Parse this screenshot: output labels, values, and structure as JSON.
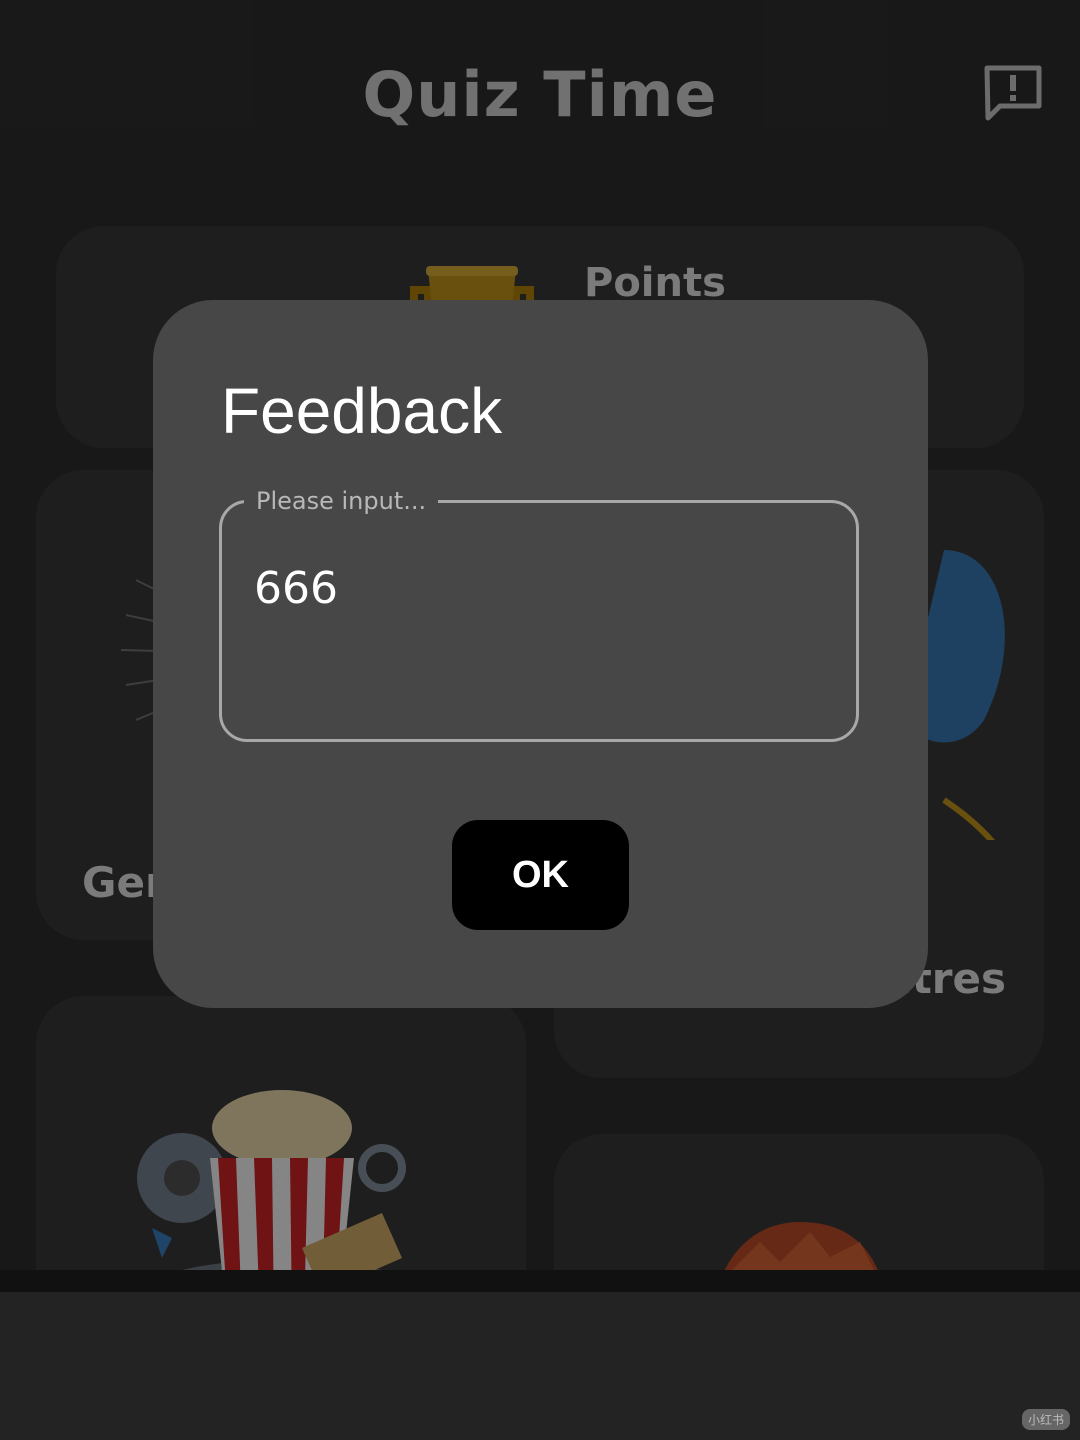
{
  "status_bar": {
    "fragment": ""
  },
  "header": {
    "title": "Quiz Time",
    "feedback_icon": "feedback-icon"
  },
  "cards": {
    "points": {
      "label": "Points",
      "icon": "trophy-icon"
    },
    "general": {
      "label": "Ger"
    },
    "theatres": {
      "label": "atres"
    },
    "movies": {
      "icon": "popcorn-ticket-image"
    },
    "anime": {
      "icon": "anime-character-image"
    }
  },
  "dialog": {
    "title": "Feedback",
    "input_placeholder": "Please input...",
    "input_value": "666",
    "ok_label": "OK"
  },
  "watermark": "小红书",
  "colors": {
    "background": "#2f2f2f",
    "card": "#3b3b3b",
    "dialog": "#474747",
    "ok_button": "#000000",
    "trophy": "#c99a1d"
  }
}
